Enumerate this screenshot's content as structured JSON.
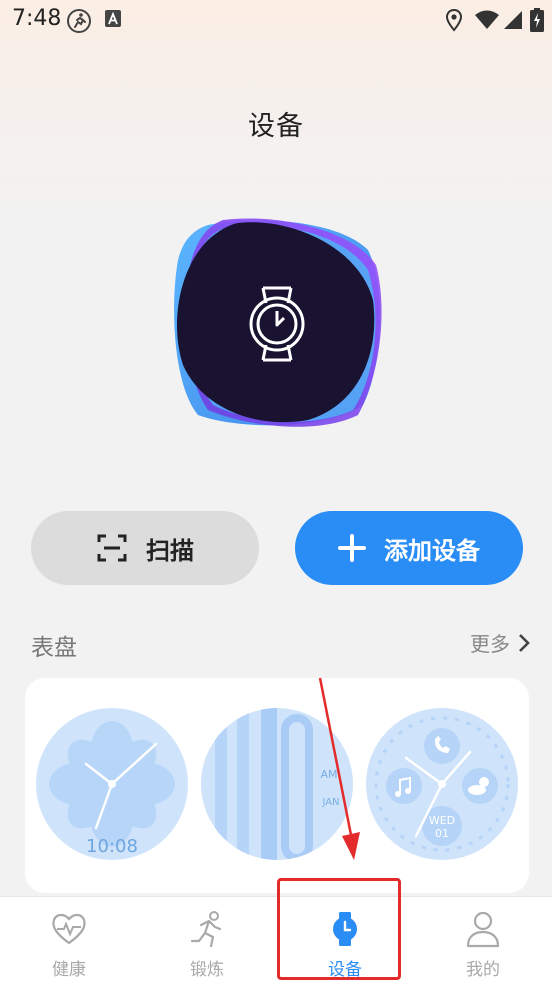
{
  "status_bar": {
    "time": "7:48",
    "left_icons": [
      "running-icon",
      "text-a-icon"
    ],
    "right_icons": [
      "location-icon",
      "wifi-icon",
      "signal-icon",
      "battery-charging-icon"
    ]
  },
  "header": {
    "title": "设备"
  },
  "hero": {
    "icon": "watch-icon",
    "colors": [
      "#4ea7f1",
      "#7a4ef0",
      "#1c1233"
    ]
  },
  "actions": {
    "scan_label": "扫描",
    "add_device_label": "添加设备"
  },
  "watch_faces": {
    "title": "表盘",
    "more_label": "更多",
    "faces": [
      {
        "name": "flower-face",
        "time_text": "10:08"
      },
      {
        "name": "stripes-face",
        "top_text": "AM",
        "date_text": "JAN"
      },
      {
        "name": "widgets-face",
        "day_text": "WED",
        "date_text": "01"
      }
    ]
  },
  "tab_bar": {
    "items": [
      {
        "label": "健康",
        "icon": "heart-pulse-icon",
        "active": false
      },
      {
        "label": "锻炼",
        "icon": "runner-icon",
        "active": false
      },
      {
        "label": "设备",
        "icon": "watch-icon",
        "active": true
      },
      {
        "label": "我的",
        "icon": "person-icon",
        "active": false
      }
    ]
  },
  "colors": {
    "accent": "#2a8cf5",
    "highlight": "#e32b2b"
  }
}
